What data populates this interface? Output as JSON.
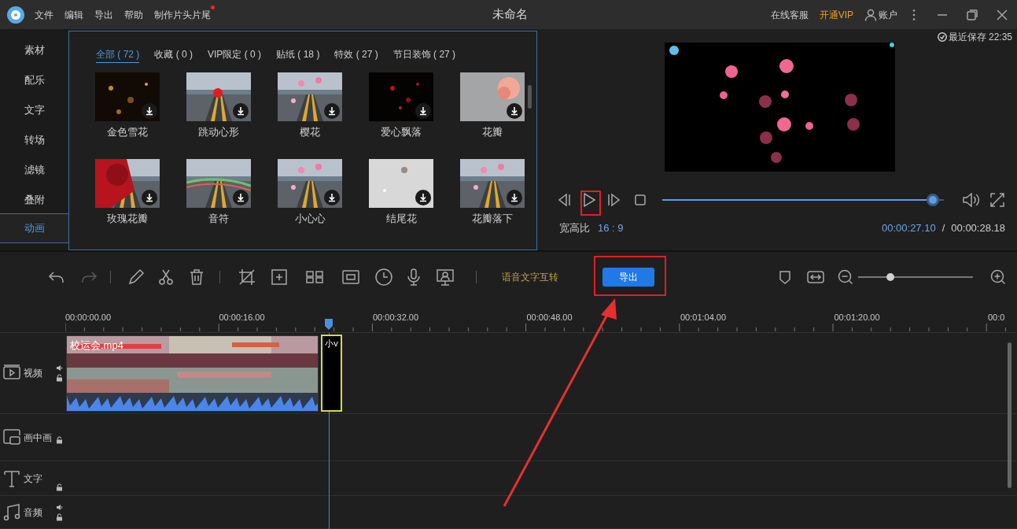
{
  "title_bar": {
    "menu": [
      {
        "label": "文件",
        "new": false
      },
      {
        "label": "编辑",
        "new": false
      },
      {
        "label": "导出",
        "new": false
      },
      {
        "label": "帮助",
        "new": false
      },
      {
        "label": "制作片头片尾",
        "new": true
      }
    ],
    "title": "未命名",
    "support": "在线客服",
    "vip": "开通VIP",
    "account": "账户"
  },
  "sidebar": {
    "items": [
      {
        "label": "素材",
        "selected": false
      },
      {
        "label": "配乐",
        "selected": false
      },
      {
        "label": "文字",
        "selected": false
      },
      {
        "label": "转场",
        "selected": false
      },
      {
        "label": "滤镜",
        "selected": false
      },
      {
        "label": "叠附",
        "selected": false
      },
      {
        "label": "动画",
        "selected": true
      }
    ]
  },
  "library": {
    "tabs": [
      {
        "label": "全部 ( 72 )",
        "selected": true
      },
      {
        "label": "收藏 ( 0 )",
        "selected": false
      },
      {
        "label": "VIP限定 ( 0 )",
        "selected": false
      },
      {
        "label": "贴纸 ( 18 )",
        "selected": false
      },
      {
        "label": "特效 ( 27 )",
        "selected": false
      },
      {
        "label": "节日装饰 ( 27 )",
        "selected": false
      }
    ],
    "items": [
      {
        "name": "金色雪花",
        "kind": "picture"
      },
      {
        "name": "跳动心形",
        "kind": "picture"
      },
      {
        "name": "樱花",
        "kind": "picture"
      },
      {
        "name": "爱心飘落",
        "kind": "picture"
      },
      {
        "name": "花瓣",
        "kind": "picture"
      },
      {
        "name": "玫瑰花瓣",
        "kind": "picture"
      },
      {
        "name": "音符",
        "kind": "picture"
      },
      {
        "name": "小心心",
        "kind": "picture"
      },
      {
        "name": "结尾花",
        "kind": "picture"
      },
      {
        "name": "花瓣落下",
        "kind": "picture"
      }
    ]
  },
  "preview": {
    "saved": "最近保存 22:35",
    "aspect_label": "宽高比",
    "aspect": "16 : 9",
    "current": "00:00:27.10",
    "separator": "/",
    "total": "00:00:28.18",
    "progress": {
      "level": 0.96
    }
  },
  "toolbar": {
    "speech": "语音文字互转",
    "export": "导出",
    "zoom": {
      "level": 0.28
    }
  },
  "ruler": {
    "ticks": [
      "00:00:00.00",
      "00:00:16.00",
      "00:00:32.00",
      "00:00:48.00",
      "00:01:04.00",
      "00:01:20.00",
      "00:0"
    ]
  },
  "tracks": [
    {
      "label": "视频",
      "kind": "video",
      "clips": [
        {
          "label": "校运会.mp4",
          "kind": "media"
        },
        {
          "label": "小v",
          "kind": "animation"
        }
      ]
    },
    {
      "label": "画中画",
      "kind": "pip"
    },
    {
      "label": "文字",
      "kind": "text"
    },
    {
      "label": "音频",
      "kind": "audio"
    }
  ]
}
